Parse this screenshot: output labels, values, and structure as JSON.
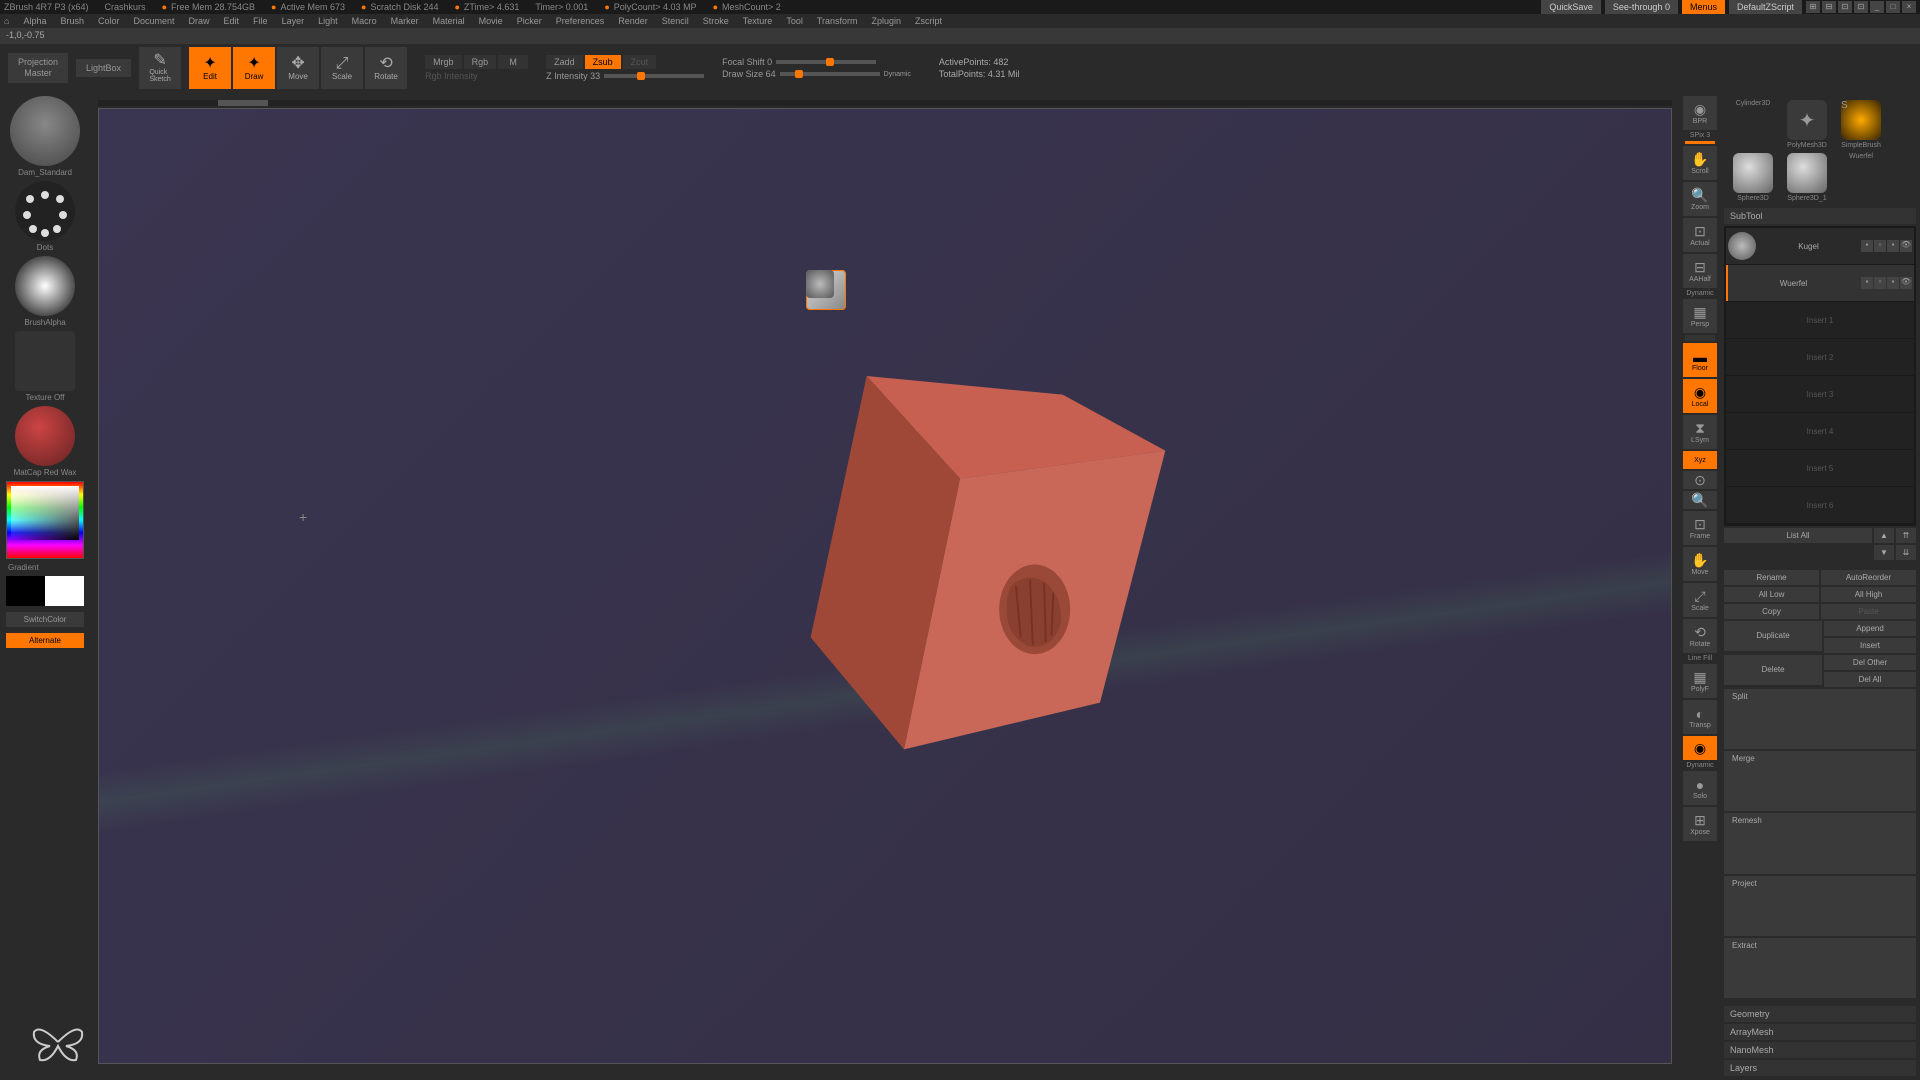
{
  "titlebar": {
    "app": "ZBrush 4R7 P3 (x64)",
    "project": "Crashkurs",
    "freemem": "Free Mem 28.754GB",
    "activemem": "Active Mem 673",
    "scratch": "Scratch Disk 244",
    "ztime": "ZTime> 4.631",
    "timer": "Timer> 0.001",
    "polycount": "PolyCount> 4.03 MP",
    "meshcount": "MeshCount> 2",
    "quicksave": "QuickSave",
    "seethrough": "See-through  0",
    "menus": "Menus",
    "defaultscript": "DefaultZScript"
  },
  "menu": [
    "Alpha",
    "Brush",
    "Color",
    "Document",
    "Draw",
    "Edit",
    "File",
    "Layer",
    "Light",
    "Macro",
    "Marker",
    "Material",
    "Movie",
    "Picker",
    "Preferences",
    "Render",
    "Stencil",
    "Stroke",
    "Texture",
    "Tool",
    "Transform",
    "Zplugin",
    "Zscript"
  ],
  "status": "-1,0,-0.75",
  "toolbar": {
    "projection": "Projection\nMaster",
    "lightbox": "LightBox",
    "quicksketch": "Quick\nSketch",
    "edit": "Edit",
    "draw": "Draw",
    "move": "Move",
    "scale": "Scale",
    "rotate": "Rotate",
    "mrgb": "Mrgb",
    "rgb": "Rgb",
    "m": "M",
    "rgbint": "Rgb Intensity",
    "zadd": "Zadd",
    "zsub": "Zsub",
    "zcut": "Zcut",
    "zint": "Z Intensity 33",
    "focal": "Focal Shift 0",
    "drawsize": "Draw Size 64",
    "dynamic": "Dynamic",
    "active": "ActivePoints: 482",
    "total": "TotalPoints: 4.31 Mil"
  },
  "leftshelf": {
    "brush": "Dam_Standard",
    "stroke": "Dots",
    "alpha": "BrushAlpha",
    "texture": "Texture Off",
    "material": "MatCap Red Wax",
    "gradient": "Gradient",
    "switchcolor": "SwitchColor",
    "alternate": "Alternate"
  },
  "rightshelf": {
    "bpr": "BPR",
    "spix": "SPix 3",
    "scroll": "Scroll",
    "zoom": "Zoom",
    "actual": "Actual",
    "aahalf": "AAHalf",
    "dynamic_l": "Dynamic",
    "persp": "Persp",
    "floor": "Floor",
    "local": "Local",
    "lsym": "LSym",
    "xyz": "Xyz",
    "frame": "Frame",
    "move": "Move",
    "scale": "Scale",
    "rotate": "Rotate",
    "linefill": "Line Fill",
    "polyf": "PolyF",
    "transp": "Transp",
    "ghost": "Dynamic",
    "solo": "Solo",
    "xpose": "Xpose"
  },
  "tools": {
    "items": [
      {
        "label": "Cylinder3D"
      },
      {
        "label": "PolyMesh3D"
      },
      {
        "label": "SimpleBrush"
      },
      {
        "label": "Sphere3D"
      },
      {
        "label": "Sphere3D_1"
      },
      {
        "label": "Wuerfel"
      }
    ]
  },
  "subtool": {
    "header": "SubTool",
    "items": [
      {
        "name": "Kugel",
        "sel": false
      },
      {
        "name": "Wuerfel",
        "sel": true
      }
    ],
    "empty": [
      "Insert 1",
      "Insert 2",
      "Insert 3",
      "Insert 4",
      "Insert 5",
      "Insert 6"
    ],
    "listall": "List All",
    "buttons": {
      "rename": "Rename",
      "autoreo": "AutoReorder",
      "alllow": "All Low",
      "allhigh": "All High",
      "copy": "Copy",
      "paste": "Paste",
      "duplicate": "Duplicate",
      "append": "Append",
      "insert": "Insert",
      "delete": "Delete",
      "delother": "Del Other",
      "delall": "Del All",
      "split": "Split",
      "merge": "Merge",
      "remesh": "Remesh",
      "project": "Project",
      "extract": "Extract"
    },
    "sections": [
      "Geometry",
      "ArrayMesh",
      "NanoMesh",
      "Layers"
    ]
  }
}
